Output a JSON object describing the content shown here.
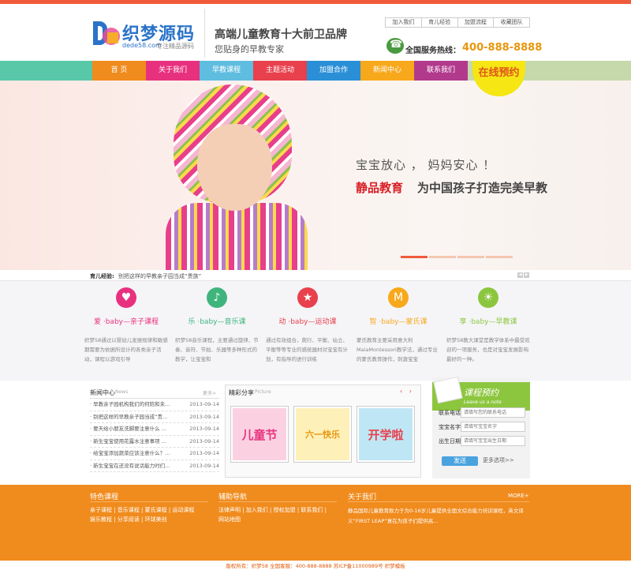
{
  "header": {
    "logo_cn": "织梦源码",
    "logo_domain": "dede58.com",
    "logo_tag": "专注精品源码",
    "slogan_main": "高端儿童教育十大前卫品牌",
    "slogan_sub": "您贴身的早教专家",
    "top_links": [
      "加入我们",
      "育儿经验",
      "加盟流程",
      "收藏团队"
    ],
    "hotline_label": "全国服务热线：",
    "hotline_number": "400-888-8888"
  },
  "nav": {
    "items": [
      {
        "label": "首 页",
        "color": "#f08b1d"
      },
      {
        "label": "关于我们",
        "color": "#e8317e"
      },
      {
        "label": "早教课程",
        "color": "#5fbde0"
      },
      {
        "label": "主题活动",
        "color": "#e8404c"
      },
      {
        "label": "加盟合作",
        "color": "#2a8fd6"
      },
      {
        "label": "新闻中心",
        "color": "#f7a81b"
      },
      {
        "label": "联系我们",
        "color": "#b23a8c"
      }
    ],
    "book_label": "在线预约"
  },
  "banner": {
    "line1": "宝宝放心 ， 妈妈安心 ！",
    "line2_highlight": "静品教育",
    "line2_rest": "为中国孩子打造完美早教"
  },
  "ticker": {
    "label": "育儿经验:",
    "text": "别把这样的早教亲子园当成“贵族”"
  },
  "courses": [
    {
      "icon": "parent-child-icon",
      "glyph": "♥",
      "color": "#e8317e",
      "title": "爱 ·baby—亲子课程",
      "desc": "织梦58通过以婴幼儿发展规律和敏感期需要为依据所设计的各类亲子活动，课程以游戏引导"
    },
    {
      "icon": "music-note-icon",
      "glyph": "♪",
      "color": "#3fb57d",
      "title": "乐 ·baby—音乐课",
      "desc": "织梦58音乐课程，主要通过旋律、节奏、音符、节拍、乐器等多种形式的教学，让宝宝和"
    },
    {
      "icon": "sport-icon",
      "glyph": "★",
      "color": "#e8404c",
      "title": "动 ·baby—运动课",
      "desc": "通过有效组合，爬行、平衡、站立、平衡等等专业的感统器材对宝宝有计划，有指导的进行训练"
    },
    {
      "icon": "montessori-icon",
      "glyph": "M",
      "color": "#f7a81b",
      "title": "智 ·baby—蒙氏课",
      "desc": "蒙氏教育主要采用意大利MaiaMontessori教学法，通过专业的蒙氏教育操作，刺激宝宝"
    },
    {
      "icon": "sun-icon",
      "glyph": "☀",
      "color": "#8cc63f",
      "title": "享 ·baby—早教课",
      "desc": "织梦58教大课堂是教学体系中最受欢迎的一项服务，也是对宝宝发展影响最好的一种。"
    }
  ],
  "news": {
    "title": "新闻中心",
    "title_en": "News",
    "more": "更多>",
    "items": [
      {
        "title": "· 早教亲子园机构我们的何陪和未...",
        "date": "2013-09-14"
      },
      {
        "title": "· 别把这样的早教亲子园当成“贵...",
        "date": "2013-09-14"
      },
      {
        "title": "· 要天给小朋友洗脚要注意什么 ...",
        "date": "2013-09-14"
      },
      {
        "title": "· 新生宝宝使用花露水注意事项 ...",
        "date": "2013-09-14"
      },
      {
        "title": "· 给宝宝添加蔬菜应该注意什么？...",
        "date": "2013-09-14"
      },
      {
        "title": "· 新生宝宝在还没有说话能力时们...",
        "date": "2013-09-14"
      }
    ]
  },
  "gallery": {
    "title": "精彩分享",
    "title_en": "Picture",
    "thumbs": [
      {
        "text": "儿童节",
        "bg": "#fbd1e2",
        "fg": "#e8317e"
      },
      {
        "text": "六一快乐",
        "bg": "#fdf0b8",
        "fg": "#e8960c"
      },
      {
        "text": "开学啦",
        "bg": "#bfe6f4",
        "fg": "#e8404c"
      }
    ]
  },
  "booking": {
    "title": "课程预约",
    "title_en": "Leave us a note",
    "fields": [
      {
        "label": "联系电话",
        "placeholder": "请填写您的联系电话"
      },
      {
        "label": "宝宝名字",
        "placeholder": "请填写宝宝名字"
      },
      {
        "label": "出生日期",
        "placeholder": "请填写宝宝出生日期"
      }
    ],
    "send": "发送",
    "more": "更多选项>>"
  },
  "footer": {
    "courses_title": "特色课程",
    "courses_line1": "亲子课程 | 音乐课程 | 蒙氏课程 | 运动课程",
    "courses_line2": "娱乐教程 | 分享阅读 | 环球美创",
    "nav_title": "辅助导航",
    "nav_line1": "法律声明 | 加入我们 | 授权加盟 | 联系我们 |",
    "nav_line2": "网站地图",
    "about_title": "关于我们",
    "about_more": "MORE+",
    "about_text": "静品国际儿童教育致力于为0-16岁儿童提供全面文综合能力培训课程，英文译义“FIRST LEAP”意在为孩子们提供高...",
    "copyright": "版权所有：织梦58 全国客服：400-888-8888 苏ICP备11000989号 织梦模板"
  }
}
